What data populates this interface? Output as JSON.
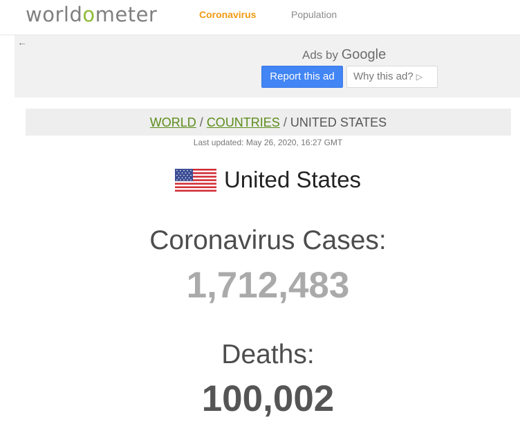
{
  "header": {
    "logo_prefix": "world",
    "logo_o": "o",
    "logo_suffix": "meter",
    "nav": [
      {
        "label": "Coronavirus",
        "active": true
      },
      {
        "label": "Population",
        "active": false
      }
    ]
  },
  "ad": {
    "back_icon": "arrow-left-icon",
    "ads_by_prefix": "Ads by ",
    "ads_by_brand": "Google",
    "report_label": "Report this ad",
    "why_label": "Why this ad?",
    "why_icon": "play-icon",
    "report_color": "#4285f4"
  },
  "breadcrumb": {
    "world": "WORLD",
    "sep1": " / ",
    "countries": "COUNTRIES",
    "sep2": " / ",
    "current": "UNITED STATES"
  },
  "last_updated": "Last updated: May 26, 2020, 16:27 GMT",
  "country": {
    "name": "United States",
    "flag_icon": "us-flag-icon"
  },
  "stats": {
    "cases_label": "Coronavirus Cases:",
    "cases_value": "1,712,483",
    "deaths_label": "Deaths:",
    "deaths_value": "100,002"
  },
  "colors": {
    "brand_green": "#8dbb3a",
    "nav_active": "#f29b12",
    "breadcrumb_link": "#5b8c1a"
  }
}
